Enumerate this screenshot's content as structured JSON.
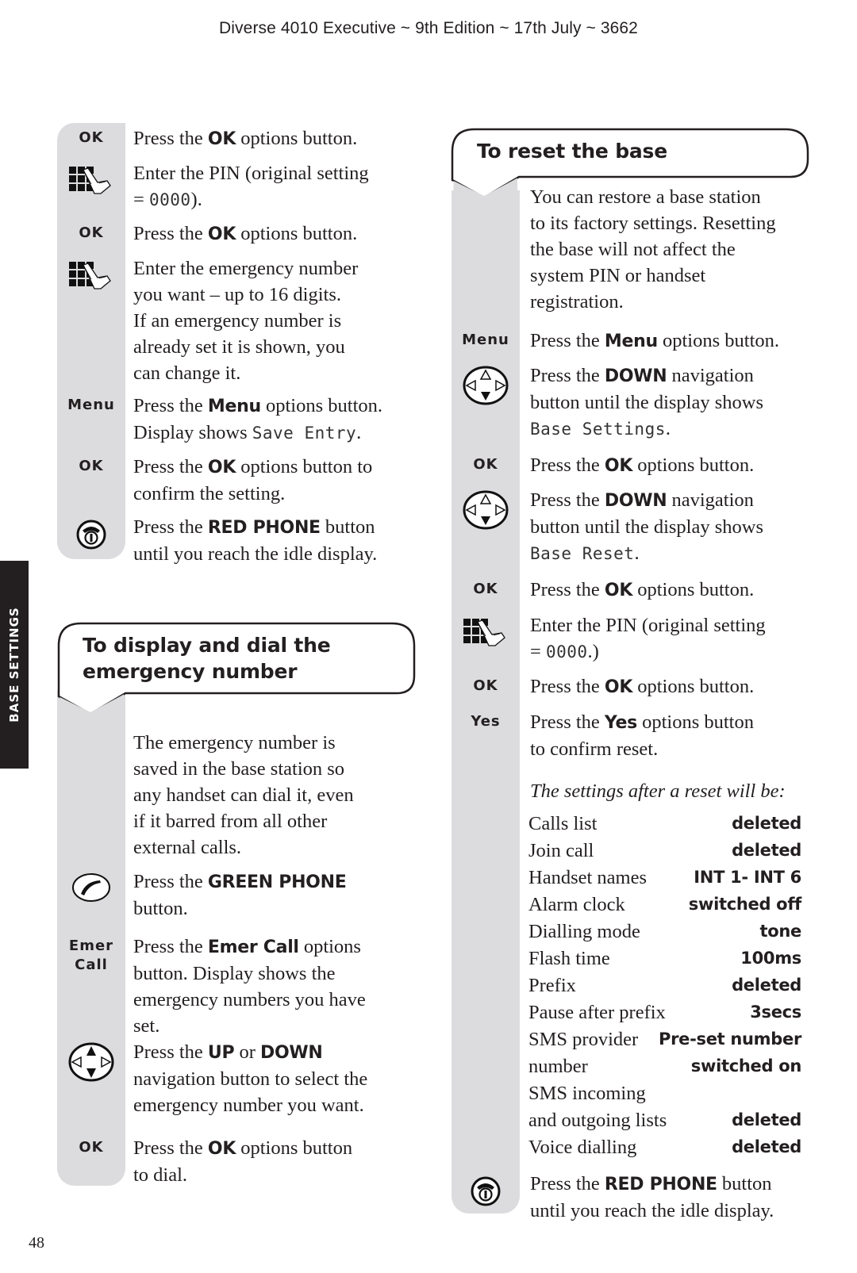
{
  "header": {
    "running_title": "Diverse 4010 Executive ~ 9th Edition ~ 17th July ~ 3662"
  },
  "side_tab": {
    "label": "BASE SETTINGS",
    "color": "#231f20"
  },
  "page_number": "48",
  "colors": {
    "gray_column": "#dcdcde",
    "text": "#231f20"
  },
  "left_column": {
    "steps_top": [
      {
        "icon": "ok-key",
        "key_label": "OK",
        "parts": [
          "Press the ",
          "OK",
          " options button."
        ]
      },
      {
        "icon": "keypad-icon",
        "parts": [
          "Enter the PIN (original setting"
        ],
        "line2_prefix": "= ",
        "line2_lcd": "0000",
        "line2_suffix": ")."
      },
      {
        "icon": "ok-key",
        "key_label": "OK",
        "parts": [
          "Press the ",
          "OK",
          " options button."
        ]
      },
      {
        "icon": "keypad-icon",
        "lines": [
          "Enter the emergency number",
          "you want – up to 16 digits.",
          "If an emergency number is",
          "already set it is shown, you",
          "can change it."
        ]
      },
      {
        "icon": "menu-key",
        "key_label": "Menu",
        "parts": [
          "Press the ",
          "Menu",
          " options button."
        ],
        "line2_prefix": "Display shows ",
        "line2_lcd": "Save Entry",
        "line2_suffix": "."
      },
      {
        "icon": "ok-key",
        "key_label": "OK",
        "parts": [
          "Press the ",
          "OK",
          " options button to"
        ],
        "line2": "confirm the setting."
      },
      {
        "icon": "red-phone-icon",
        "parts": [
          "Press the ",
          "RED PHONE",
          " button"
        ],
        "line2": "until you reach the idle display."
      }
    ],
    "section2": {
      "heading_line1": "To display and dial the",
      "heading_line2": "emergency number",
      "intro_lines": [
        "The emergency number is",
        "saved in the base station so",
        "any handset can dial it, even",
        "if it barred from all other",
        "external calls."
      ],
      "steps": [
        {
          "icon": "green-phone-icon",
          "parts": [
            "Press the ",
            "GREEN PHONE",
            ""
          ],
          "line2": "button."
        },
        {
          "icon": "emer-call-key",
          "key_label_1": "Emer",
          "key_label_2": "Call",
          "parts": [
            "Press the ",
            "Emer Call",
            " options"
          ],
          "lines_rest": [
            "button. Display shows the",
            "emergency numbers you have",
            "set."
          ]
        },
        {
          "icon": "nav-up-down-icon",
          "parts": [
            "Press the ",
            "UP",
            " or ",
            "DOWN"
          ],
          "lines_rest": [
            "navigation button to select the",
            "emergency number you want."
          ]
        },
        {
          "icon": "ok-key",
          "key_label": "OK",
          "parts": [
            "Press the ",
            "OK",
            " options button"
          ],
          "line2": "to dial."
        }
      ]
    }
  },
  "right_column": {
    "heading": "To reset the base",
    "intro_lines": [
      "You can restore a base station",
      "to its factory settings. Resetting",
      "the base will not affect the",
      "system PIN or handset",
      "registration."
    ],
    "steps": [
      {
        "icon": "menu-key",
        "key_label": "Menu",
        "parts": [
          "Press the ",
          "Menu",
          " options button."
        ]
      },
      {
        "icon": "nav-down-icon",
        "parts": [
          "Press the ",
          "DOWN",
          " navigation"
        ],
        "line2": "button until the display shows",
        "line3_lcd": "Base Settings",
        "line3_suffix": "."
      },
      {
        "icon": "ok-key",
        "key_label": "OK",
        "parts": [
          "Press the ",
          "OK",
          " options button."
        ]
      },
      {
        "icon": "nav-down-icon",
        "parts": [
          "Press the ",
          "DOWN",
          " navigation"
        ],
        "line2": "button until the display shows",
        "line3_lcd": "Base Reset",
        "line3_suffix": "."
      },
      {
        "icon": "ok-key",
        "key_label": "OK",
        "parts": [
          "Press the ",
          "OK",
          " options button."
        ]
      },
      {
        "icon": "keypad-icon",
        "parts": [
          "Enter the PIN (original setting"
        ],
        "line2_prefix": "= ",
        "line2_lcd": "0000",
        "line2_suffix": ".)"
      },
      {
        "icon": "ok-key",
        "key_label": "OK",
        "parts": [
          "Press the ",
          "OK",
          " options button."
        ]
      },
      {
        "icon": "yes-key",
        "key_label": "Yes",
        "parts": [
          "Press the ",
          "Yes",
          " options button"
        ],
        "line2": "to confirm reset."
      }
    ],
    "settings_caption": "The settings after a reset will be:",
    "settings": [
      {
        "label": "Calls list",
        "value": "deleted"
      },
      {
        "label": "Join call",
        "value": "deleted"
      },
      {
        "label": "Handset names",
        "value": "INT 1- INT 6"
      },
      {
        "label": "Alarm clock",
        "value": "switched off"
      },
      {
        "label": "Dialling mode",
        "value": "tone"
      },
      {
        "label": "Flash time",
        "value": "100ms"
      },
      {
        "label": "Prefix",
        "value": "deleted"
      },
      {
        "label": "Pause after prefix",
        "value": "3secs"
      },
      {
        "label": "SMS provider",
        "value": "Pre-set number"
      },
      {
        "label": "number",
        "value": "switched on"
      },
      {
        "label": "SMS incoming",
        "value": ""
      },
      {
        "label": "and outgoing lists",
        "value": "deleted"
      },
      {
        "label": "Voice dialling",
        "value": "deleted"
      }
    ],
    "final_step": {
      "icon": "red-phone-icon",
      "parts": [
        "Press the ",
        "RED PHONE",
        " button"
      ],
      "line2": "until you reach the idle display."
    }
  }
}
